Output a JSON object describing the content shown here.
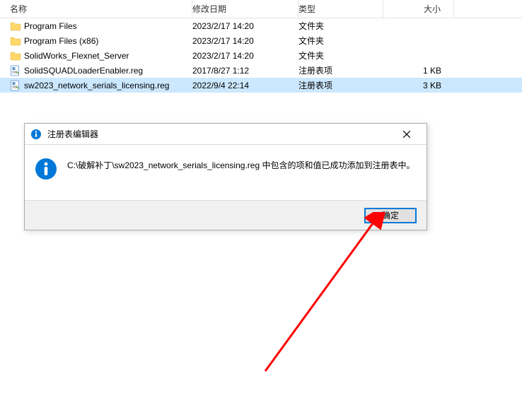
{
  "columns": {
    "name": "名称",
    "date": "修改日期",
    "type": "类型",
    "size": "大小"
  },
  "rows": [
    {
      "icon": "folder",
      "name": "Program Files",
      "date": "2023/2/17 14:20",
      "type": "文件夹",
      "size": "",
      "selected": false
    },
    {
      "icon": "folder",
      "name": "Program Files (x86)",
      "date": "2023/2/17 14:20",
      "type": "文件夹",
      "size": "",
      "selected": false
    },
    {
      "icon": "folder",
      "name": "SolidWorks_Flexnet_Server",
      "date": "2023/2/17 14:20",
      "type": "文件夹",
      "size": "",
      "selected": false
    },
    {
      "icon": "reg",
      "name": "SolidSQUADLoaderEnabler.reg",
      "date": "2017/8/27 1:12",
      "type": "注册表项",
      "size": "1 KB",
      "selected": false
    },
    {
      "icon": "reg",
      "name": "sw2023_network_serials_licensing.reg",
      "date": "2022/9/4 22:14",
      "type": "注册表项",
      "size": "3 KB",
      "selected": true
    }
  ],
  "dialog": {
    "title": "注册表编辑器",
    "message": "C:\\破解补丁\\sw2023_network_serials_licensing.reg 中包含的项和值已成功添加到注册表中。",
    "ok_label": "确定"
  }
}
